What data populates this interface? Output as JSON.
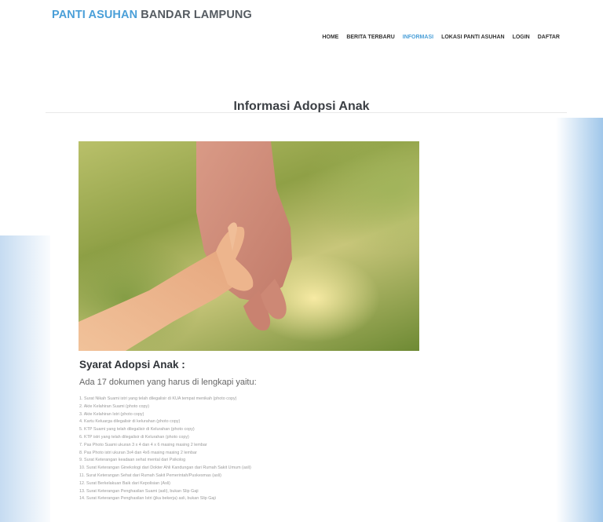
{
  "header": {
    "brand_part1": "PANTI ASUHAN",
    "brand_part2": "BANDAR LAMPUNG",
    "nav": [
      "HOME",
      "BERITA TERBARU",
      "INFORMASI",
      "LOKASI PANTI ASUHAN",
      "LOGIN",
      "DAFTAR"
    ],
    "active_nav": "INFORMASI"
  },
  "main": {
    "title": "Informasi Adopsi Anak",
    "image_icon": "adoption-hands-photo",
    "subtitle": "Syarat Adopsi Anak :",
    "intro": "Ada 17 dokumen yang harus di lengkapi yaitu:",
    "requirements": [
      "1. Surat Nikah Suami istri yang telah dilegalisir di KUA tempat menikah (photo copy)",
      "2. Akte Kelahiran Suami (photo copy)",
      "3. Akte Kelahiran Istri (photo copy)",
      "4. Kartu Keluarga dilegalisir di kelurahan (photo copy)",
      "5. KTP Suami yang telah dilegalisir di Kelurahan (photo copy)",
      "6. KTP istri yang telah dilegalisir di Kelurahan (photo copy)",
      "7. Pas Photo Suami ukuran 3 x 4 dan 4 x 6 masing masing 2 lembar",
      "8. Pas Photo istri ukuran 3x4 dan 4x6 masing masing 2 lembar",
      "9. Surat Keterangan keadaan sehat mental dari Psikolog",
      "10. Surat Keterangan Ginekologi dari Dokter Ahli Kandungan dari Rumah Sakit Umum (asli)",
      "11. Surat Keterangan Sehat dari Rumah Sakit Pemerintah/Puskesmas (asli)",
      "12. Surat Berkelakuan Baik dari Kepolisian (Asli)",
      "13. Surat Keterangan Penghasilan Suami (asli), bukan Slip Gaji",
      "14. Surat Keterangan Penghasilan Istri (jika bekerja) asli, bukan Slip Gaji"
    ]
  },
  "colors": {
    "accent": "#4a9fd8",
    "brand_dark": "#555b61"
  }
}
